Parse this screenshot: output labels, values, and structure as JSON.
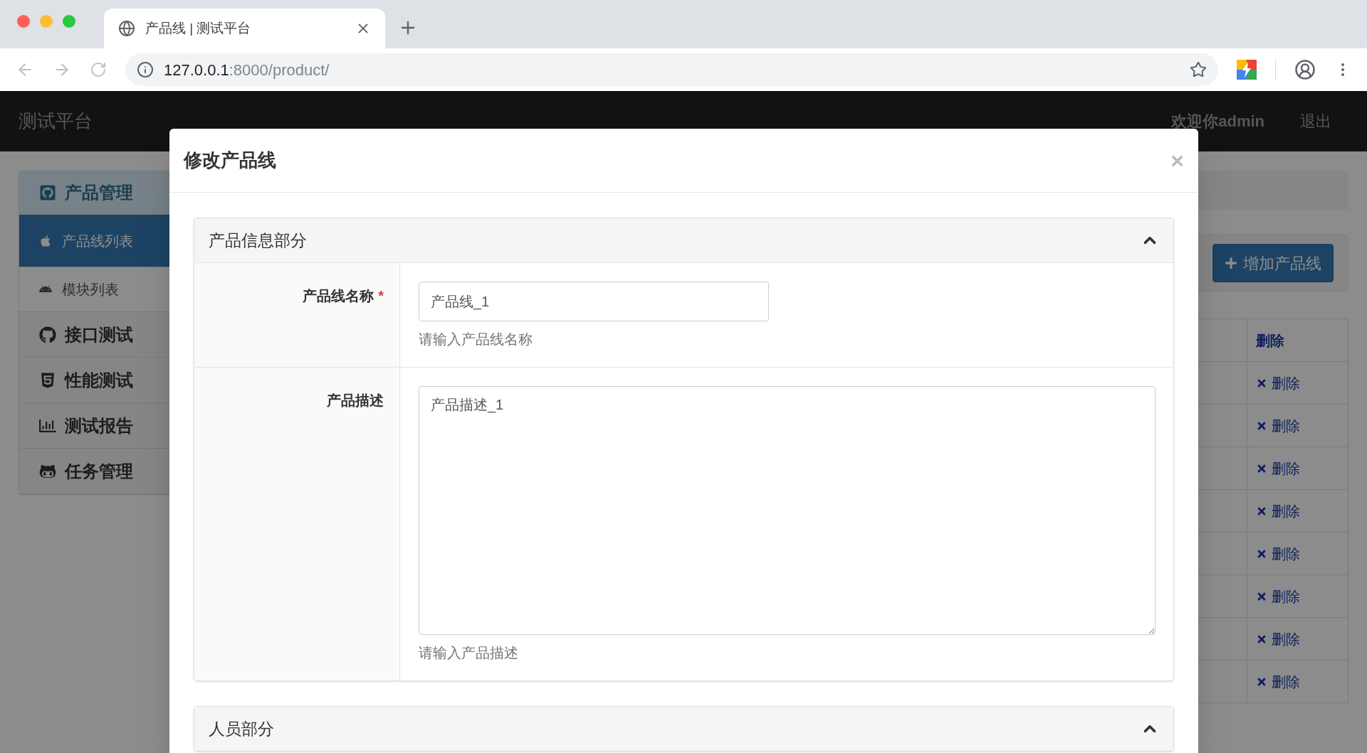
{
  "browser": {
    "tab_title": "产品线 | 测试平台",
    "url_host": "127.0.0.1",
    "url_rest": ":8000/product/"
  },
  "navbar": {
    "brand": "测试平台",
    "welcome": "欢迎你admin",
    "logout": "退出"
  },
  "sidebar": {
    "items": [
      {
        "label": "产品管理",
        "expanded": true,
        "children": [
          {
            "label": "产品线列表",
            "selected": true
          },
          {
            "label": "模块列表",
            "selected": false
          }
        ]
      },
      {
        "label": "接口测试",
        "expanded": false
      },
      {
        "label": "性能测试",
        "expanded": false
      },
      {
        "label": "测试报告",
        "expanded": false
      },
      {
        "label": "任务管理",
        "expanded": false
      }
    ]
  },
  "toolbar": {
    "add_button": "增加产品线"
  },
  "table": {
    "columns": [
      "删除"
    ],
    "rows": [
      {
        "delete": "删除"
      },
      {
        "delete": "删除"
      },
      {
        "delete": "删除"
      },
      {
        "delete": "删除"
      },
      {
        "delete": "删除"
      },
      {
        "delete": "删除"
      },
      {
        "delete": "删除"
      },
      {
        "delete": "删除"
      }
    ]
  },
  "modal": {
    "title": "修改产品线",
    "close": "×",
    "sections": [
      {
        "title": "产品信息部分",
        "expanded": true,
        "fields": [
          {
            "kind": "input",
            "label": "产品线名称",
            "required_mark": "*",
            "value": "产品线_1",
            "help": "请输入产品线名称"
          },
          {
            "kind": "textarea",
            "label": "产品描述",
            "value": "产品描述_1",
            "help": "请输入产品描述"
          }
        ]
      },
      {
        "title": "人员部分",
        "expanded": true
      }
    ]
  }
}
